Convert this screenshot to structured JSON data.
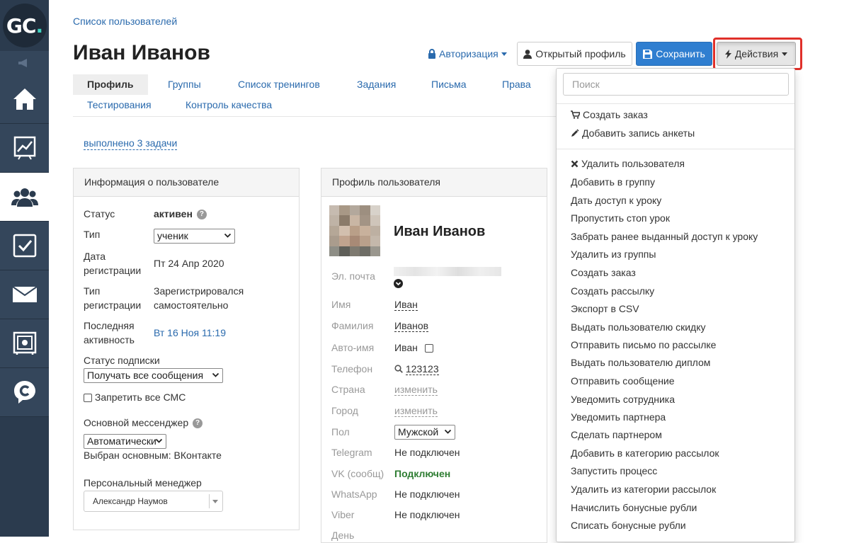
{
  "sidebar": {
    "logo_text": "GC",
    "logo_dot": ".",
    "items": [
      {
        "name": "home-icon"
      },
      {
        "name": "chart-icon"
      },
      {
        "name": "users-icon"
      },
      {
        "name": "tasks-icon"
      },
      {
        "name": "mail-icon"
      },
      {
        "name": "safe-icon"
      },
      {
        "name": "chat-icon"
      }
    ]
  },
  "header": {
    "breadcrumb": "Список пользователей",
    "title": "Иван Иванов",
    "auth_label": "Авторизация",
    "open_profile_label": "Открытый профиль",
    "save_label": "Сохранить",
    "actions_label": "Действия"
  },
  "tabs": [
    "Профиль",
    "Группы",
    "Список тренингов",
    "Задания",
    "Письма",
    "Права",
    "Тестирования",
    "Контроль качества"
  ],
  "done_link": "выполнено 3 задачи",
  "info_panel": {
    "title": "Информация о пользователе",
    "status_label": "Статус",
    "status_value": "активен",
    "type_label": "Тип",
    "type_value": "ученик",
    "reg_date_label_1": "Дата",
    "reg_date_label_2": "регистрации",
    "reg_date_value": "Пт 24 Апр 2020",
    "reg_type_label_1": "Тип",
    "reg_type_label_2": "регистрации",
    "reg_type_value_1": "Зарегистрировался",
    "reg_type_value_2": "самостоятельно",
    "last_active_label_1": "Последняя",
    "last_active_label_2": "активность",
    "last_active_value": "Вт 16 Ноя 11:19",
    "subscription_label": "Статус подписки",
    "subscription_value": "Получать все сообщения",
    "sms_label": "Запретить все СМС",
    "messenger_label": "Основной мессенджер",
    "messenger_value": "Автоматически",
    "messenger_note": "Выбран основным: ВКонтакте",
    "manager_label": "Персональный менеджер",
    "manager_value": "Александр Наумов"
  },
  "profile_panel": {
    "title": "Профиль пользователя",
    "name": "Иван Иванов",
    "email_label": "Эл. почта",
    "first_name_label": "Имя",
    "first_name_value": "Иван",
    "last_name_label": "Фамилия",
    "last_name_value": "Иванов",
    "auto_name_label": "Авто-имя",
    "auto_name_value": "Иван",
    "phone_label": "Телефон",
    "phone_value": "123123",
    "country_label": "Страна",
    "country_value": "изменить",
    "city_label": "Город",
    "city_value": "изменить",
    "gender_label": "Пол",
    "gender_value": "Мужской",
    "telegram_label": "Telegram",
    "telegram_value": "Не подключен",
    "vk_label": "VK (сообщ)",
    "vk_value": "Подключен",
    "whatsapp_label": "WhatsApp",
    "whatsapp_value": "Не подключен",
    "viber_label": "Viber",
    "viber_value": "Не подключен",
    "cut_label": "День"
  },
  "actions_menu": {
    "search_placeholder": "Поиск",
    "top_items": [
      "Создать заказ",
      "Добавить запись анкеты"
    ],
    "items": [
      "Удалить пользователя",
      "Добавить в группу",
      "Дать доступ к уроку",
      "Пропустить стоп урок",
      "Забрать ранее выданный доступ к уроку",
      "Удалить из группы",
      "Создать заказ",
      "Создать рассылку",
      "Экспорт в CSV",
      "Выдать пользователю скидку",
      "Отправить письмо по рассылке",
      "Выдать пользователю диплом",
      "Отправить сообщение",
      "Уведомить сотрудника",
      "Уведомить партнера",
      "Сделать партнером",
      "Добавить в категорию рассылок",
      "Запустить процесс",
      "Удалить из категории рассылок",
      "Начислить бонусные рубли",
      "Списать бонусные рубли"
    ]
  },
  "colors": {
    "sidebar": "#2b3b4e",
    "link": "#2a6aad",
    "save_button": "#2f7ed0",
    "highlight": "#e0302a",
    "connected": "#2e7d32"
  }
}
